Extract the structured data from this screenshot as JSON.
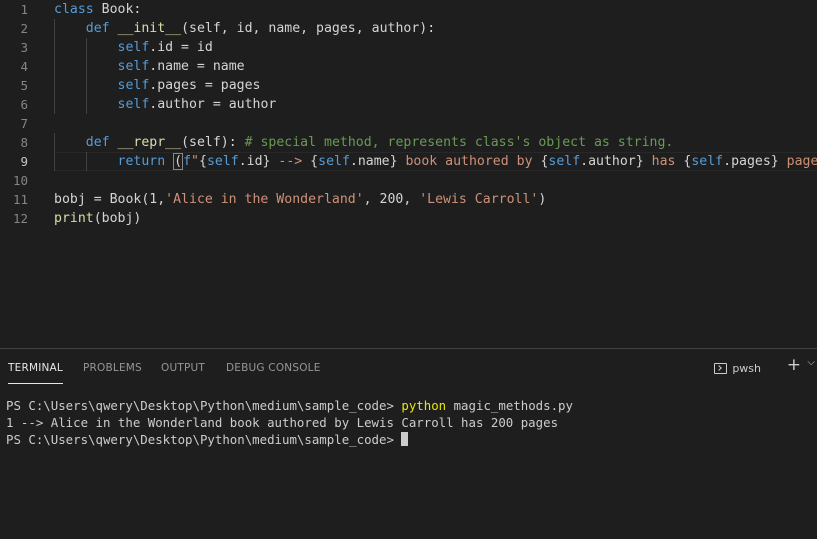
{
  "editor": {
    "lines": [
      {
        "num": "1",
        "tokens": [
          {
            "t": "class",
            "c": "kw"
          },
          {
            "t": " Book:",
            "c": ""
          }
        ]
      },
      {
        "num": "2",
        "tokens": [
          {
            "t": "    "
          },
          {
            "t": "def",
            "c": "kw"
          },
          {
            "t": " "
          },
          {
            "t": "__init__",
            "c": "fn"
          },
          {
            "t": "(self, id, name, pages, author):"
          }
        ]
      },
      {
        "num": "3",
        "tokens": [
          {
            "t": "        "
          },
          {
            "t": "self",
            "c": "self"
          },
          {
            "t": ".id = id"
          }
        ]
      },
      {
        "num": "4",
        "tokens": [
          {
            "t": "        "
          },
          {
            "t": "self",
            "c": "self"
          },
          {
            "t": ".name = name"
          }
        ]
      },
      {
        "num": "5",
        "tokens": [
          {
            "t": "        "
          },
          {
            "t": "self",
            "c": "self"
          },
          {
            "t": ".pages = pages"
          }
        ]
      },
      {
        "num": "6",
        "tokens": [
          {
            "t": "        "
          },
          {
            "t": "self",
            "c": "self"
          },
          {
            "t": ".author = author"
          }
        ]
      },
      {
        "num": "7",
        "tokens": []
      },
      {
        "num": "8",
        "tokens": [
          {
            "t": "    "
          },
          {
            "t": "def",
            "c": "kw"
          },
          {
            "t": " "
          },
          {
            "t": "__repr__",
            "c": "fn"
          },
          {
            "t": "(self): "
          },
          {
            "t": "# special method, represents class's object as string.",
            "c": "cm"
          }
        ]
      },
      {
        "num": "9",
        "active": true,
        "tokens": [
          {
            "t": "        "
          },
          {
            "t": "return",
            "c": "kw"
          },
          {
            "t": " "
          },
          {
            "t": "(",
            "c": "box"
          },
          {
            "t": "f",
            "c": "kw"
          },
          {
            "t": "\"",
            "c": "str"
          },
          {
            "t": "{"
          },
          {
            "t": "self",
            "c": "self"
          },
          {
            "t": ".id}"
          },
          {
            "t": " --> ",
            "c": "str"
          },
          {
            "t": "{"
          },
          {
            "t": "self",
            "c": "self"
          },
          {
            "t": ".name}"
          },
          {
            "t": " book authored by ",
            "c": "str"
          },
          {
            "t": "{"
          },
          {
            "t": "self",
            "c": "self"
          },
          {
            "t": ".author}"
          },
          {
            "t": " has ",
            "c": "str"
          },
          {
            "t": "{"
          },
          {
            "t": "self",
            "c": "self"
          },
          {
            "t": ".pages}"
          },
          {
            "t": " pages\"",
            "c": "str"
          },
          {
            "t": ")",
            "c": "box"
          }
        ]
      },
      {
        "num": "10",
        "tokens": []
      },
      {
        "num": "11",
        "tokens": [
          {
            "t": "bobj = Book(1,"
          },
          {
            "t": "'Alice in the Wonderland'",
            "c": "str"
          },
          {
            "t": ", 200, "
          },
          {
            "t": "'Lewis Carroll'",
            "c": "str"
          },
          {
            "t": ")"
          }
        ]
      },
      {
        "num": "12",
        "tokens": [
          {
            "t": "print",
            "c": "fn"
          },
          {
            "t": "(bobj)"
          }
        ]
      }
    ]
  },
  "panel": {
    "tabs": [
      "TERMINAL",
      "PROBLEMS",
      "OUTPUT",
      "DEBUG CONSOLE"
    ],
    "shell_name": "pwsh",
    "plus_symbol": "+",
    "dropdown_symbol": "⌵"
  },
  "terminal": {
    "prompt1": "PS C:\\Users\\qwery\\Desktop\\Python\\medium\\sample_code> ",
    "command": "python",
    "args": " magic_methods.py",
    "output": "1 --> Alice in the Wonderland book authored by Lewis Carroll has 200 pages",
    "prompt2": "PS C:\\Users\\qwery\\Desktop\\Python\\medium\\sample_code> "
  }
}
